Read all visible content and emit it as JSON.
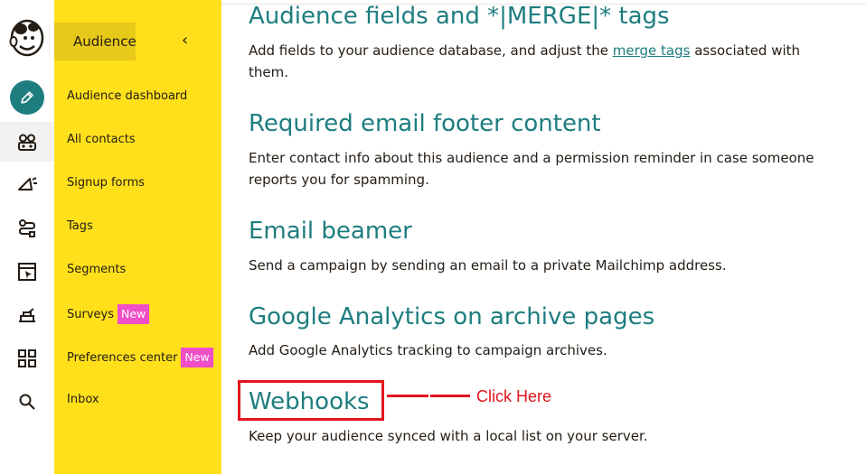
{
  "rail": {
    "icons": [
      "mailchimp-logo",
      "pencil-create-icon",
      "audience-icon",
      "campaigns-icon",
      "automations-icon",
      "website-icon",
      "content-studio-icon",
      "integrations-grid-icon",
      "search-icon"
    ]
  },
  "subnav": {
    "header": "Audience",
    "collapse_glyph": "‹",
    "items": [
      {
        "label": "Audience dashboard"
      },
      {
        "label": "All contacts"
      },
      {
        "label": "Signup forms"
      },
      {
        "label": "Tags"
      },
      {
        "label": "Segments"
      },
      {
        "label": "Surveys",
        "badge": "New"
      },
      {
        "label": "Preferences center",
        "badge": "New"
      },
      {
        "label": "Inbox"
      }
    ]
  },
  "sections": [
    {
      "title": "Audience fields and *|MERGE|* tags",
      "desc_before": "Add fields to your audience database, and adjust the ",
      "desc_link": "merge tags",
      "desc_after": " associated with them."
    },
    {
      "title": "Required email footer content",
      "desc": "Enter contact info about this audience and a permission reminder in case someone reports you for spamming."
    },
    {
      "title": "Email beamer",
      "desc": "Send a campaign by sending an email to a private Mailchimp address."
    },
    {
      "title": "Google Analytics on archive pages",
      "desc": "Add Google Analytics tracking to campaign archives."
    },
    {
      "title": "Webhooks",
      "desc": "Keep your audience synced with a local list on your server."
    }
  ],
  "annotation": {
    "text": "Click Here",
    "color": "#e3141e"
  },
  "colors": {
    "brand_yellow": "#ffe01b",
    "teal": "#1e7d7f",
    "badge_pink": "#f04ec6"
  }
}
